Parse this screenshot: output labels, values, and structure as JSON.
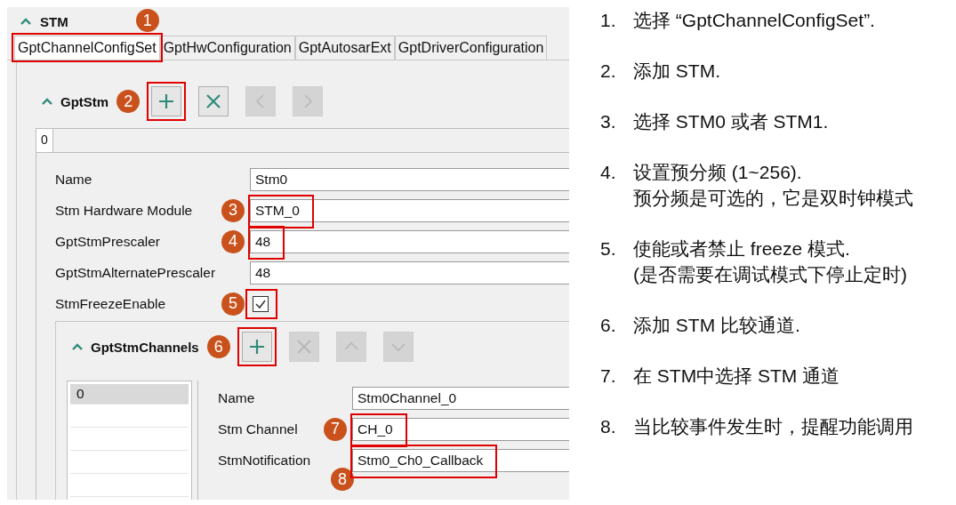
{
  "section": {
    "title": "STM",
    "expanded": true,
    "marker": "1"
  },
  "tabs": [
    {
      "label": "GptChannelConfigSet",
      "selected": true,
      "highlighted": true
    },
    {
      "label": "GptHwConfiguration",
      "selected": false,
      "highlighted": false
    },
    {
      "label": "GptAutosarExt",
      "selected": false,
      "highlighted": false
    },
    {
      "label": "GptDriverConfiguration",
      "selected": false,
      "highlighted": false
    }
  ],
  "gpt_stm": {
    "title": "GptStm",
    "expanded": true,
    "marker": "2",
    "toolbar": [
      {
        "kind": "add",
        "disabled": false,
        "highlighted": true
      },
      {
        "kind": "remove",
        "disabled": false,
        "highlighted": false
      },
      {
        "kind": "left",
        "disabled": true,
        "highlighted": false
      },
      {
        "kind": "right",
        "disabled": true,
        "highlighted": false
      }
    ],
    "index_tabs": [
      {
        "label": "0",
        "selected": true
      }
    ],
    "fields": [
      {
        "kind": "text",
        "label": "Name",
        "value": "Stm0",
        "highlighted": false
      },
      {
        "kind": "text",
        "label": "Stm Hardware Module",
        "value": "STM_0",
        "marker": "3",
        "highlighted": true
      },
      {
        "kind": "text",
        "label": "GptStmPrescaler",
        "value": "48",
        "marker": "4",
        "highlighted": true
      },
      {
        "kind": "text",
        "label": "GptStmAlternatePrescaler",
        "value": "48",
        "highlighted": false
      },
      {
        "kind": "checkbox",
        "label": "StmFreezeEnable",
        "checked": true,
        "marker": "5",
        "highlighted": true
      }
    ]
  },
  "channels": {
    "title": "GptStmChannels",
    "expanded": true,
    "marker": "6",
    "toolbar": [
      {
        "kind": "add",
        "disabled": false,
        "highlighted": true
      },
      {
        "kind": "remove",
        "disabled": true,
        "highlighted": false
      },
      {
        "kind": "up",
        "disabled": true,
        "highlighted": false
      },
      {
        "kind": "down",
        "disabled": true,
        "highlighted": false
      }
    ],
    "list": [
      {
        "label": "0",
        "selected": true
      }
    ],
    "fields": [
      {
        "kind": "text",
        "label": "Name",
        "value": "Stm0Channel_0",
        "highlighted": false
      },
      {
        "kind": "text",
        "label": "Stm Channel",
        "value": "CH_0",
        "marker": "7",
        "highlighted": true
      },
      {
        "kind": "text",
        "label": "StmNotification",
        "value": "Stm0_Ch0_Callback",
        "marker": "8",
        "marker_below": true,
        "highlighted": true
      }
    ]
  },
  "steps": [
    {
      "number": "1.",
      "lines": [
        "选择 “GptChannelConfigSet”."
      ]
    },
    {
      "number": "2.",
      "lines": [
        "添加 STM."
      ]
    },
    {
      "number": "3.",
      "lines": [
        "选择 STM0 或者 STM1."
      ]
    },
    {
      "number": "4.",
      "lines": [
        "设置预分频 (1~256).",
        "预分频是可选的，它是双时钟模式"
      ]
    },
    {
      "number": "5.",
      "lines": [
        "使能或者禁止 freeze 模式.",
        "(是否需要在调试模式下停止定时)"
      ]
    },
    {
      "number": "6.",
      "lines": [
        "添加 STM 比较通道."
      ]
    },
    {
      "number": "7.",
      "lines": [
        "在 STM中选择 STM 通道"
      ]
    },
    {
      "number": "8.",
      "lines": [
        "当比较事件发生时，提醒功能调用"
      ]
    }
  ]
}
